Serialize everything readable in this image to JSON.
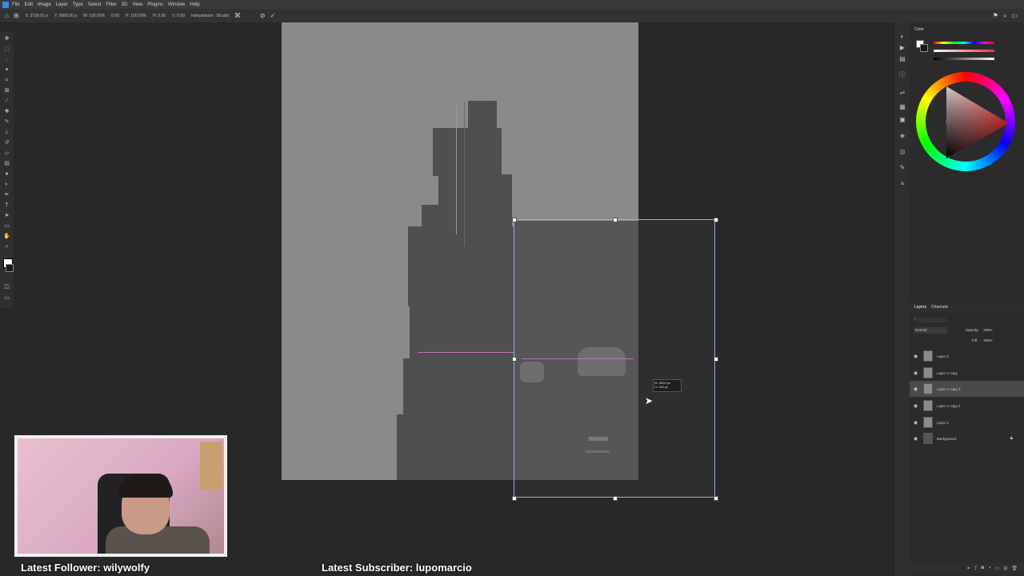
{
  "menubar": {
    "items": [
      "File",
      "Edit",
      "Image",
      "Layer",
      "Type",
      "Select",
      "Filter",
      "3D",
      "View",
      "Plugins",
      "Window",
      "Help"
    ]
  },
  "options": {
    "x_value": "X: 3739.91 p",
    "y_value": "Y: 5689.00 p",
    "w_value": "W: 100.00%",
    "angle_value": "0.00",
    "h_value": "H: 100.00%",
    "h_skew": "H: 0.00",
    "v_skew": "V: 0.00",
    "interpolation_label": "Interpolation:",
    "interpolation_value": "Bicubic"
  },
  "tooltip": {
    "line1": "W: 2694 px",
    "line2": "H: 143 px"
  },
  "color_panel": {
    "title": "Color"
  },
  "layers_panel": {
    "tabs": [
      "Layers",
      "Channels"
    ],
    "blend_mode": "Normal",
    "opacity_label": "Opacity:",
    "opacity_value": "100%",
    "fill_label": "Fill:",
    "fill_value": "100%",
    "layers": [
      {
        "name": "Layer 2",
        "selected": false
      },
      {
        "name": "Layer 1 copy",
        "selected": false
      },
      {
        "name": "Layer 1 copy 3",
        "selected": true
      },
      {
        "name": "Layer 1 copy 2",
        "selected": false
      },
      {
        "name": "Layer 1",
        "selected": false
      },
      {
        "name": "Background",
        "selected": false
      }
    ]
  },
  "overlay": {
    "follower": "Latest Follower: wilywolfy",
    "subscriber": "Latest Subscriber: lupomarcio"
  }
}
